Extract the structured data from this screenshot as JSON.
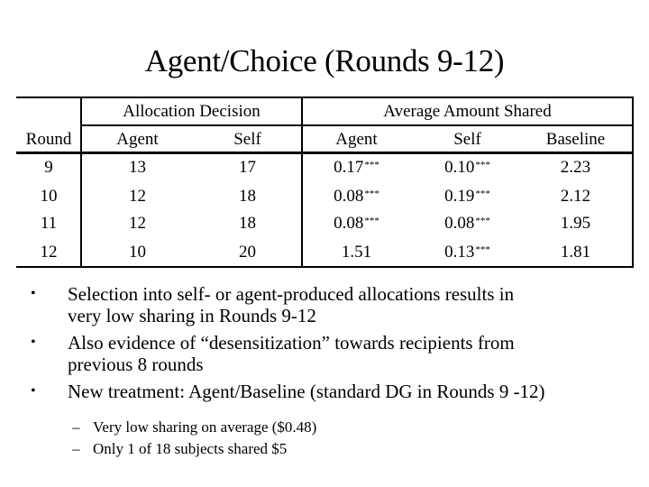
{
  "slide": {
    "title": "Agent/Choice (Rounds 9-12)"
  },
  "table": {
    "group_headers": {
      "allocation": "Allocation Decision",
      "average": "Average Amount Shared"
    },
    "columns": [
      "Round",
      "Agent",
      "Self",
      "Agent",
      "Self",
      "Baseline"
    ],
    "rows": [
      {
        "round": "9",
        "alloc_agent": "13",
        "alloc_self": "17",
        "avg_agent": "0.17",
        "avg_agent_sig": "***",
        "avg_self": "0.10",
        "avg_self_sig": "***",
        "baseline": "2.23"
      },
      {
        "round": "10",
        "alloc_agent": "12",
        "alloc_self": "18",
        "avg_agent": "0.08",
        "avg_agent_sig": "***",
        "avg_self": "0.19",
        "avg_self_sig": "***",
        "baseline": "2.12"
      },
      {
        "round": "11",
        "alloc_agent": "12",
        "alloc_self": "18",
        "avg_agent": "0.08",
        "avg_agent_sig": "***",
        "avg_self": "0.08",
        "avg_self_sig": "***",
        "baseline": "1.95"
      },
      {
        "round": "12",
        "alloc_agent": "10",
        "alloc_self": "20",
        "avg_agent": "1.51",
        "avg_agent_sig": "",
        "avg_self": "0.13",
        "avg_self_sig": "***",
        "baseline": "1.81"
      }
    ]
  },
  "bullets": [
    {
      "lines": [
        "Selection into self- or agent-produced allocations results in",
        "very low sharing in Rounds 9-12"
      ]
    },
    {
      "lines": [
        "Also evidence of “desensitization” towards recipients from",
        "previous 8 rounds"
      ]
    },
    {
      "lines": [
        "New treatment: Agent/Baseline (standard DG in Rounds 9 -12)"
      ]
    }
  ],
  "sub_bullets": [
    "Very low sharing on average ($0.48)",
    "Only 1 of 18 subjects shared $5"
  ],
  "glyphs": {
    "bullet": "•",
    "dash": "–"
  }
}
